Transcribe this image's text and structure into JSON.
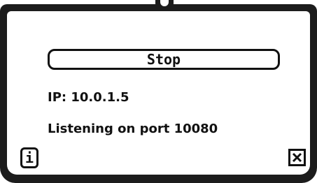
{
  "dialog": {
    "stop_button_label": "Stop",
    "ip_text": "IP: 10.0.1.5",
    "status_text": "Listening on port 10080",
    "info_button_label": "i"
  },
  "icons": {
    "info": "info-icon",
    "close": "close-icon"
  },
  "colors": {
    "frame": "#1c1c1c",
    "background": "#ffffff",
    "text": "#111111"
  }
}
